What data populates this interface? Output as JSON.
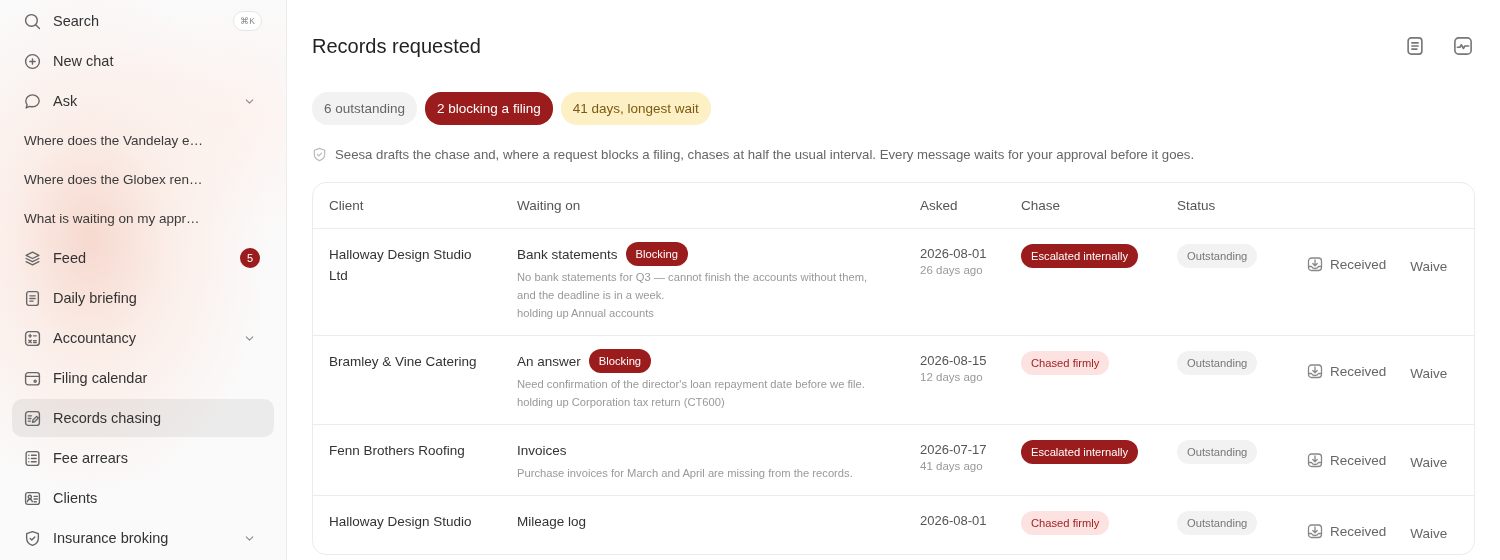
{
  "sidebar": {
    "search": {
      "label": "Search",
      "shortcut": "⌘K"
    },
    "items": [
      {
        "label": "New chat",
        "selected": false,
        "collapsible": false
      },
      {
        "label": "Ask",
        "selected": false,
        "collapsible": true,
        "children": [
          {
            "label": "Where does the Vandelay e…",
            "selected": false
          },
          {
            "label": "Where does the Globex ren…",
            "selected": false
          },
          {
            "label": "What is waiting on my appr…",
            "selected": false
          }
        ]
      },
      {
        "label": "Feed",
        "selected": false,
        "collapsible": false,
        "badge": "5"
      },
      {
        "label": "Daily briefing",
        "selected": false,
        "collapsible": false
      },
      {
        "label": "Accountancy",
        "selected": false,
        "collapsible": true
      },
      {
        "label": "Filing calendar",
        "selected": false,
        "collapsible": false
      },
      {
        "label": "Records chasing",
        "selected": true,
        "collapsible": false
      },
      {
        "label": "Fee arrears",
        "selected": false,
        "collapsible": false
      },
      {
        "label": "Clients",
        "selected": false,
        "collapsible": false
      },
      {
        "label": "Insurance broking",
        "selected": false,
        "collapsible": true
      }
    ]
  },
  "page": {
    "title": "Records requested",
    "summary": [
      {
        "label": "6 outstanding",
        "kind": "neutral"
      },
      {
        "label": "2 blocking a filing",
        "kind": "danger"
      },
      {
        "label": "41 days, longest wait",
        "kind": "warning"
      }
    ],
    "note": "Seesa drafts the chase and, where a request blocks a filing, chases at half the usual interval. Every message waits for your approval before it goes."
  },
  "table": {
    "columns": [
      "Client",
      "Waiting on",
      "Asked",
      "Chase",
      "Status"
    ],
    "rows": [
      {
        "client": "Halloway Design Studio Ltd",
        "item": "Bank statements",
        "blocking": true,
        "blocking_label": "Blocking",
        "details": [
          "No bank statements for Q3 — cannot finish the accounts without them, and the deadline is in a week.",
          "holding up Annual accounts"
        ],
        "asked": "2026-08-01",
        "ago": "26 days ago",
        "chase": {
          "label": "Escalated internally",
          "kind": "escalated"
        },
        "status": "Outstanding",
        "actions": [
          "Received",
          "Waive"
        ]
      },
      {
        "client": "Bramley & Vine Catering",
        "item": "An answer",
        "blocking": true,
        "blocking_label": "Blocking",
        "details": [
          "Need confirmation of the director's loan repayment date before we file.",
          "holding up Corporation tax return (CT600)"
        ],
        "asked": "2026-08-15",
        "ago": "12 days ago",
        "chase": {
          "label": "Chased firmly",
          "kind": "firm"
        },
        "status": "Outstanding",
        "actions": [
          "Received",
          "Waive"
        ]
      },
      {
        "client": "Fenn Brothers Roofing",
        "item": "Invoices",
        "blocking": false,
        "details": [
          "Purchase invoices for March and April are missing from the records."
        ],
        "asked": "2026-07-17",
        "ago": "41 days ago",
        "chase": {
          "label": "Escalated internally",
          "kind": "escalated"
        },
        "status": "Outstanding",
        "actions": [
          "Received",
          "Waive"
        ]
      },
      {
        "client": "Halloway Design Studio",
        "item": "Mileage log",
        "blocking": false,
        "details": [],
        "asked": "2026-08-01",
        "chase": {
          "label": "Chased firmly",
          "kind": "firm"
        },
        "status": "Outstanding",
        "actions": [
          "Received",
          "Waive"
        ]
      }
    ]
  }
}
